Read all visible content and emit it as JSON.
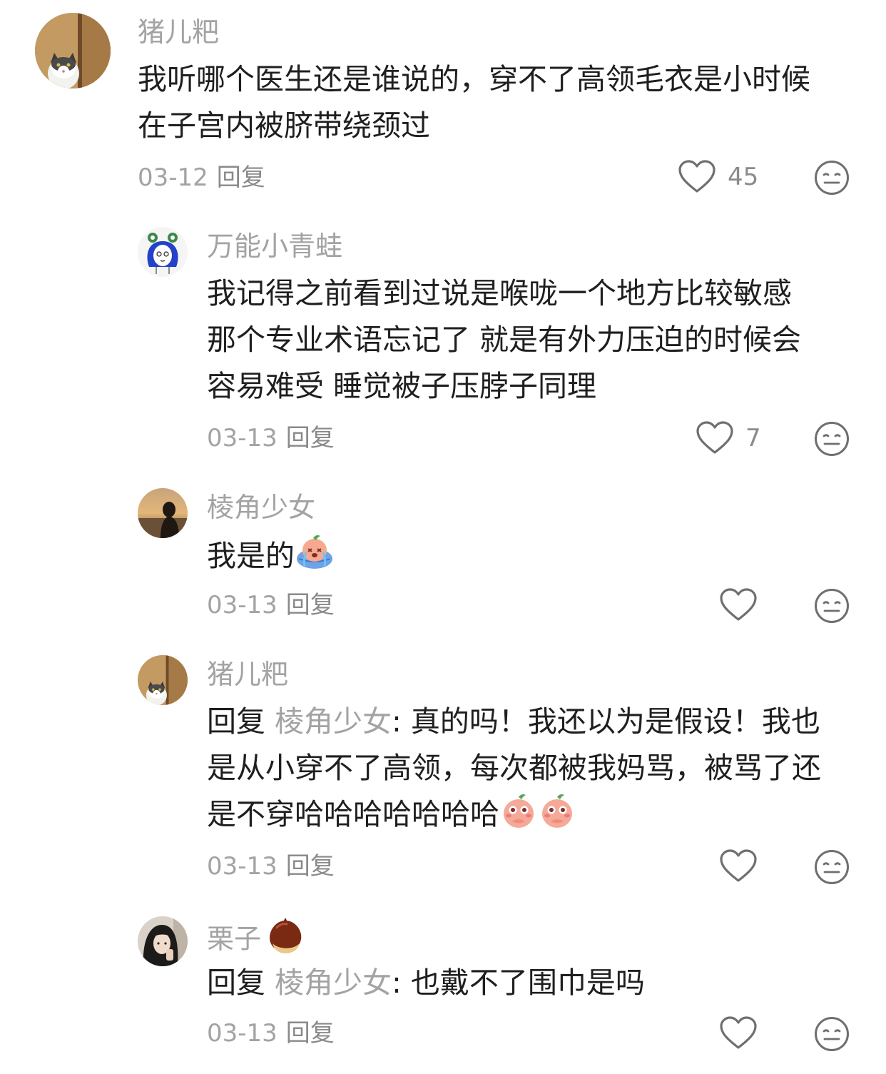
{
  "comments": [
    {
      "author": "猪儿粑",
      "avatar": "cat-avatar",
      "lines": [
        "我听哪个医生还是谁说的，穿不了高领毛衣是小时候",
        "在子宫内被脐带绕颈过"
      ],
      "date": "03-12",
      "reply_label": "回复",
      "likes": "45"
    },
    {
      "author": "万能小青蛙",
      "avatar": "frog-girl-avatar",
      "lines": [
        "我记得之前看到过说是喉咙一个地方比较敏感",
        "那个专业术语忘记了 就是有外力压迫的时候会",
        "容易难受   睡觉被子压脖子同理"
      ],
      "date": "03-13",
      "reply_label": "回复",
      "likes": "7"
    },
    {
      "author": "棱角少女",
      "avatar": "sunset-avatar",
      "lines": [
        "我是的"
      ],
      "emoji": "crying-peach-emoji",
      "date": "03-13",
      "reply_label": "回复",
      "likes": ""
    },
    {
      "author": "猪儿粑",
      "avatar": "cat-avatar",
      "reply_prefix": "回复",
      "reply_target": "棱角少女",
      "lines": [
        ": 真的吗！我还以为是假设！我也",
        "是从小穿不了高领，每次都被我妈骂，被骂了还",
        "是不穿哈哈哈哈哈哈哈"
      ],
      "emoji": "shy-peach-emoji",
      "date": "03-13",
      "reply_label": "回复",
      "likes": ""
    },
    {
      "author": "栗子",
      "author_emoji": "chestnut-emoji",
      "avatar": "dark-hair-avatar",
      "reply_prefix": "回复",
      "reply_target": "棱角少女",
      "lines": [
        ": 也戴不了围巾是吗"
      ],
      "date": "03-13",
      "reply_label": "回复",
      "likes": ""
    }
  ],
  "colors": {
    "text": "#1f1f1f",
    "muted": "#a3a3a3",
    "icon": "#8a8a8a"
  }
}
